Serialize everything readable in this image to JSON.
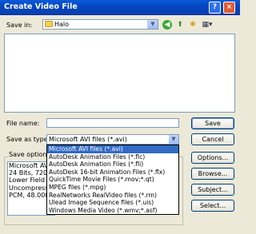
{
  "window": {
    "title": "Create Video File",
    "help_glyph": "?",
    "close_glyph": "×"
  },
  "save_in": {
    "label": "Save in:",
    "value": "Halo"
  },
  "icons": [
    "back-icon",
    "up-folder-icon",
    "new-folder-icon",
    "view-menu-icon"
  ],
  "file_name": {
    "label": "File name:",
    "value": ""
  },
  "save_as_type": {
    "label": "Save as type:",
    "value": "Microsoft AVI files (*.avi)"
  },
  "save_options": {
    "label": "Save options:"
  },
  "options_text": [
    "Microsoft AVI",
    "24 Bits, 720 x",
    "Lower Field F",
    "Uncompress",
    "PCM, 48.000"
  ],
  "dropdown_options": [
    "Microsoft AVI files (*.avi)",
    "AutoDesk Animation Files (*.flc)",
    "AutoDesk Animation Files (*.fli)",
    "AutoDesk 16-bit Animation Files (*.flx)",
    "QuickTime Movie Files (*.mov;*.qt)",
    "MPEG files (*.mpg)",
    "RealNetworks RealVideo files (*.rm)",
    "Ulead Image Sequence files (*.uis)",
    "Windows Media Video (*.wmv;*.asf)"
  ],
  "selected_option_index": 0,
  "buttons": {
    "save": "Save",
    "cancel": "Cancel",
    "options": "Options...",
    "browse": "Browse...",
    "subject": "Subject...",
    "select": "Select..."
  }
}
